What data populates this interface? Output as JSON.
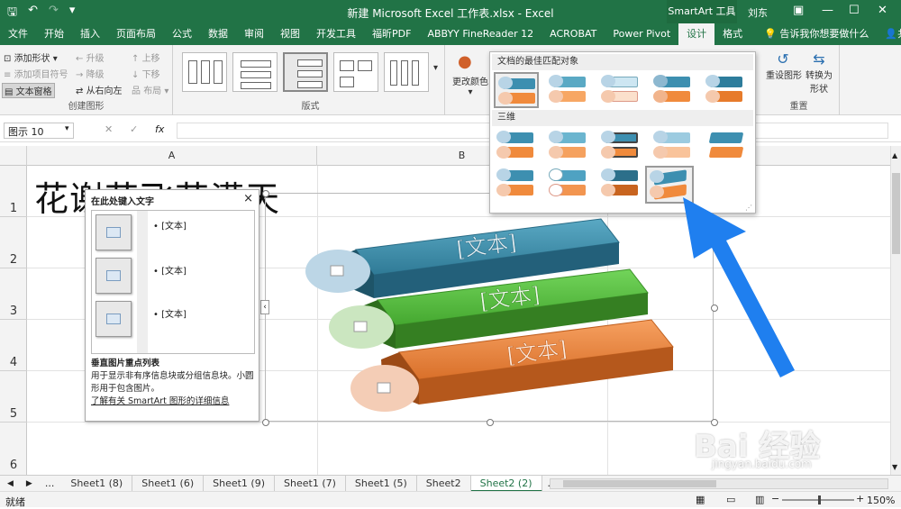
{
  "title": "新建 Microsoft Excel 工作表.xlsx - Excel",
  "context_tab": "SmartArt 工具",
  "user": "刘东",
  "tabs": [
    "文件",
    "开始",
    "插入",
    "页面布局",
    "公式",
    "数据",
    "审阅",
    "视图",
    "开发工具",
    "福昕PDF",
    "ABBYY FineReader 12",
    "ACROBAT",
    "Power Pivot",
    "设计",
    "格式"
  ],
  "tell_me": "告诉我你想要做什么",
  "share": "共享",
  "ribbon": {
    "create_group": {
      "add_shape": "添加形状",
      "add_bullet": "添加项目符号",
      "text_pane": "文本窗格",
      "promote": "升级",
      "demote": "降级",
      "right_to_left": "从右向左",
      "move_up": "上移",
      "move_down": "下移",
      "layout": "布局",
      "label": "创建图形"
    },
    "layouts_label": "版式",
    "change_colors": "更改颜色",
    "reset_graphic": "重设图形",
    "convert_to_shapes": "转换为形状",
    "reset_label": "重置"
  },
  "name_box": "图示 10",
  "fx": "fx",
  "columns": [
    "A",
    "B"
  ],
  "rows": [
    "1",
    "2",
    "3",
    "4",
    "5",
    "6"
  ],
  "cell_a1": "花谢花飞花满天",
  "text_pane": {
    "title": "在此处键入文字",
    "close": "×",
    "bullets": [
      "[文本]",
      "[文本]",
      "[文本]"
    ],
    "layout_name": "垂直图片重点列表",
    "description": "用于显示非有序信息块或分组信息块。小圆形用于包含图片。",
    "link": "了解有关 SmartArt 图形的详细信息"
  },
  "gallery": {
    "section1": "文档的最佳匹配对象",
    "section2": "三维"
  },
  "smartart_labels": [
    "[文本]",
    "[文本]",
    "[文本]"
  ],
  "smartart_colors": {
    "blue": "#3c8ca8",
    "green": "#5bc342",
    "orange": "#ee8838",
    "blue_circle": "#bcd6e6",
    "green_circle": "#cbe6c0",
    "orange_circle": "#f4cdb6"
  },
  "sheets": [
    "Sheet1 (8)",
    "Sheet1 (6)",
    "Sheet1 (9)",
    "Sheet1 (7)",
    "Sheet1 (5)",
    "Sheet2",
    "Sheet2 (2)"
  ],
  "status": "就绪",
  "zoom": "150%",
  "watermark": "Bai 经验",
  "watermark_url": "jingyan.baidu.com"
}
